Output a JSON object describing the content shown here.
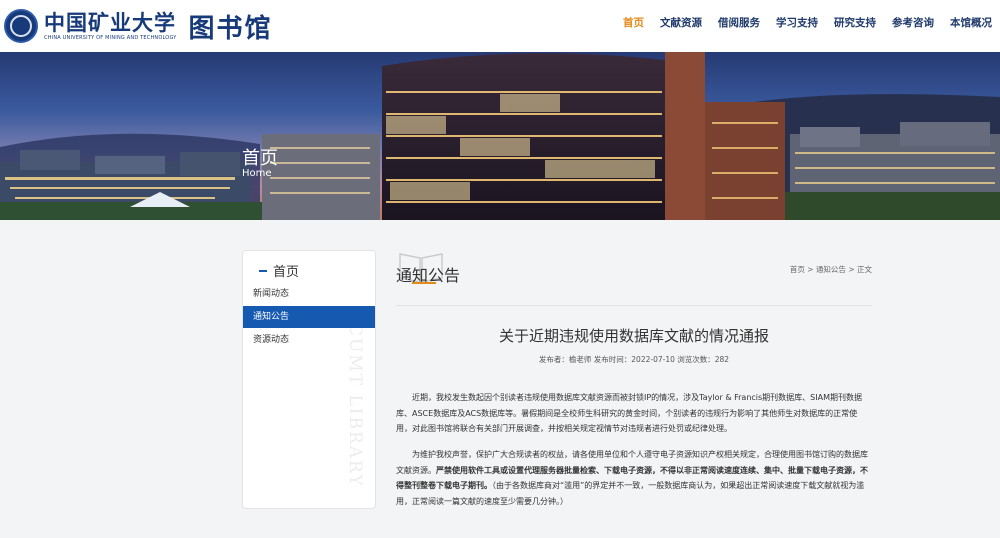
{
  "header": {
    "logo_cn": "中国矿业大学",
    "logo_en": "CHINA UNIVERSITY OF MINING AND TECHNOLOGY",
    "logo_library": "图书馆",
    "nav": [
      "首页",
      "文献资源",
      "借阅服务",
      "学习支持",
      "研究支持",
      "参考咨询",
      "本馆概况"
    ],
    "active_nav": 0
  },
  "banner": {
    "title": "首页",
    "subtitle": "Home"
  },
  "sidebar": {
    "heading": "首页",
    "items": [
      {
        "label": "新闻动态"
      },
      {
        "label": "通知公告"
      },
      {
        "label": "资源动态"
      }
    ],
    "active_item": 1,
    "watermark": "CUMT LIBRARY"
  },
  "main": {
    "section_title": "通知公告",
    "breadcrumb": [
      "首页",
      "通知公告",
      "正文"
    ],
    "breadcrumb_sep": " > ",
    "article": {
      "title": "关于近期违规使用数据库文献的情况通报",
      "meta": "发布者：榆老师  发布时间：2022-07-10  浏览次数：282",
      "p1": "近期，我校发生数起因个别读者违规使用数据库文献资源而被封锁IP的情况，涉及Taylor & Francis期刊数据库、SIAM期刊数据库、ASCE数据库及ACS数据库等。暑假期间是全校师生科研究的黄金时间，个别读者的违规行为影响了其他师生对数据库的正常使用，对此图书馆将联合有关部门开展调查，并按相关规定视情节对违规者进行处罚或纪律处理。",
      "p2_a": "为维护我校声誉，保护广大合规读者的权益，请各使用单位和个人遵守电子资源知识产权相关规定，合理使用图书馆订购的数据库文献资源。",
      "p2_bold": "严禁使用软件工具或设置代理服务器批量检索、下载电子资源，不得以非正常阅读速度连续、集中、批量下载电子资源，不得整刊整卷下载电子期刊。",
      "p2_b": "（由于各数据库商对“滥用”的界定并不一致，一般数据库商认为，如果超出正常阅读速度下载文献就视为滥用，正常阅读一篇文献的速度至少需要几分钟。）"
    }
  },
  "colors": {
    "accent": "#e48a1a",
    "primary": "#1559b0",
    "brand": "#173a7a"
  }
}
